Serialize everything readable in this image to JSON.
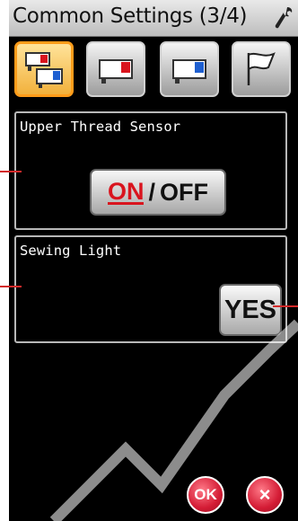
{
  "header": {
    "title": "Common Settings (3/4)",
    "settings_icon": "wrench-icon"
  },
  "tabs": [
    {
      "name": "tab-1",
      "icon": "machine-pair-icon",
      "active": true
    },
    {
      "name": "tab-2",
      "icon": "machine-red-icon",
      "active": false
    },
    {
      "name": "tab-3",
      "icon": "machine-blue-icon",
      "active": false
    },
    {
      "name": "tab-4",
      "icon": "flag-icon",
      "active": false
    }
  ],
  "upper_thread": {
    "label": "Upper Thread Sensor",
    "on_label": "ON",
    "separator": "/",
    "off_label": "OFF"
  },
  "sewing_light": {
    "label": "Sewing Light",
    "yes_label": "YES"
  },
  "footer": {
    "ok_label": "OK",
    "cancel_icon": "close-icon",
    "cancel_label": "×"
  },
  "colors": {
    "active_tab": "#f2b13c",
    "accent_red": "#d9141e",
    "callout": "#d32a2a"
  }
}
